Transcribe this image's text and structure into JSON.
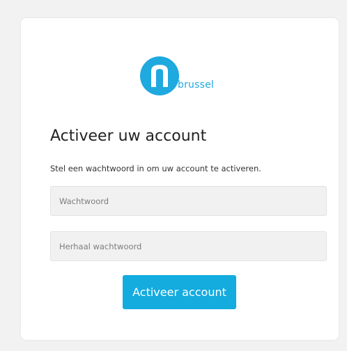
{
  "brand": {
    "name": "brussel",
    "color": "#1ea9df"
  },
  "form": {
    "title": "Activeer uw account",
    "instruction": "Stel een wachtwoord in om uw account te activeren.",
    "password_placeholder": "Wachtwoord",
    "password_value": "",
    "repeat_placeholder": "Herhaal wachtwoord",
    "repeat_value": "",
    "submit_label": "Activeer account"
  },
  "colors": {
    "page_background": "#f2f2f2",
    "card_background": "#ffffff",
    "field_background": "#f1f1f1",
    "button_background": "#14abdf",
    "button_text": "#ffffff"
  }
}
